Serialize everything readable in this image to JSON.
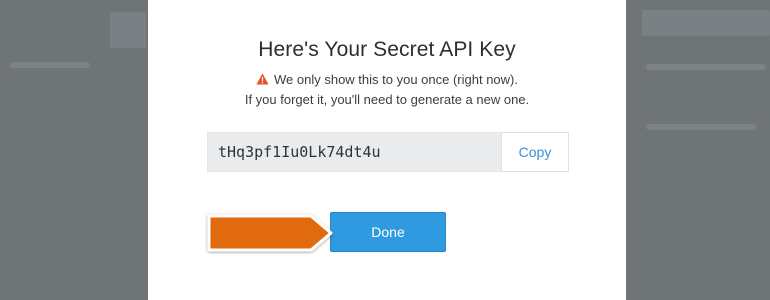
{
  "modal": {
    "title": "Here's Your Secret API Key",
    "warning_text": "We only show this to you once (right now).",
    "subtext": "If you forget it, you'll need to generate a new one.",
    "api_key": "tHq3pf1Iu0Lk74dt4u",
    "copy_label": "Copy",
    "done_label": "Done"
  },
  "icons": {
    "warning": "warning-triangle-icon",
    "pointer": "orange-arrow-pointer"
  },
  "colors": {
    "primary_button": "#2f9ae0",
    "link": "#3a8fd6",
    "warning": "#e0542c",
    "annotation_arrow": "#e06a10",
    "backdrop": "#6f7477"
  }
}
